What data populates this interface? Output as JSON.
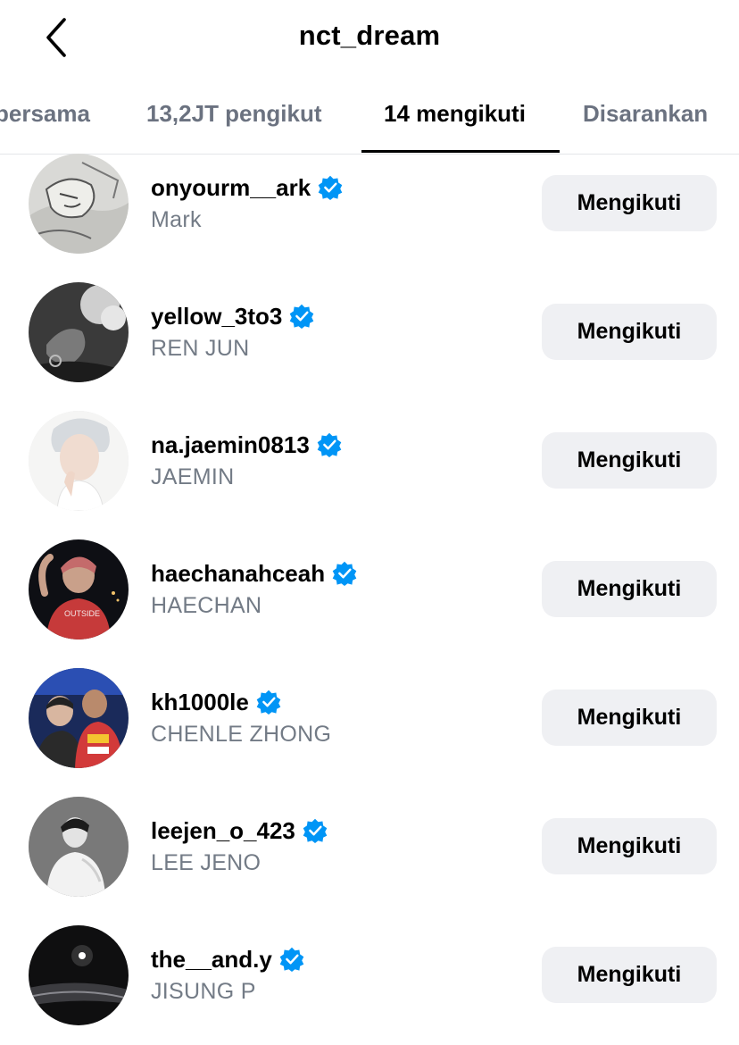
{
  "header": {
    "title": "nct_dream",
    "back_icon": "chevron-left-icon"
  },
  "tabs": [
    {
      "label": "bersama",
      "active": false
    },
    {
      "label": "13,2JT pengikut",
      "active": false
    },
    {
      "label": "14 mengikuti",
      "active": true
    },
    {
      "label": "Disarankan",
      "active": false
    }
  ],
  "following": [
    {
      "username": "onyourm__ark",
      "full_name": "Mark",
      "verified": true,
      "button_label": "Mengikuti"
    },
    {
      "username": "yellow_3to3",
      "full_name": "REN JUN",
      "verified": true,
      "button_label": "Mengikuti"
    },
    {
      "username": "na.jaemin0813",
      "full_name": "JAEMIN",
      "verified": true,
      "button_label": "Mengikuti"
    },
    {
      "username": "haechanahceah",
      "full_name": "HAECHAN",
      "verified": true,
      "button_label": "Mengikuti"
    },
    {
      "username": "kh1000le",
      "full_name": "CHENLE ZHONG",
      "verified": true,
      "button_label": "Mengikuti"
    },
    {
      "username": "leejen_o_423",
      "full_name": "LEE JENO",
      "verified": true,
      "button_label": "Mengikuti"
    },
    {
      "username": "the__and.y",
      "full_name": "JISUNG P",
      "verified": true,
      "button_label": "Mengikuti"
    }
  ],
  "colors": {
    "verified_badge": "#0095f6",
    "secondary_text": "#737b86",
    "button_bg": "#eff0f3"
  }
}
